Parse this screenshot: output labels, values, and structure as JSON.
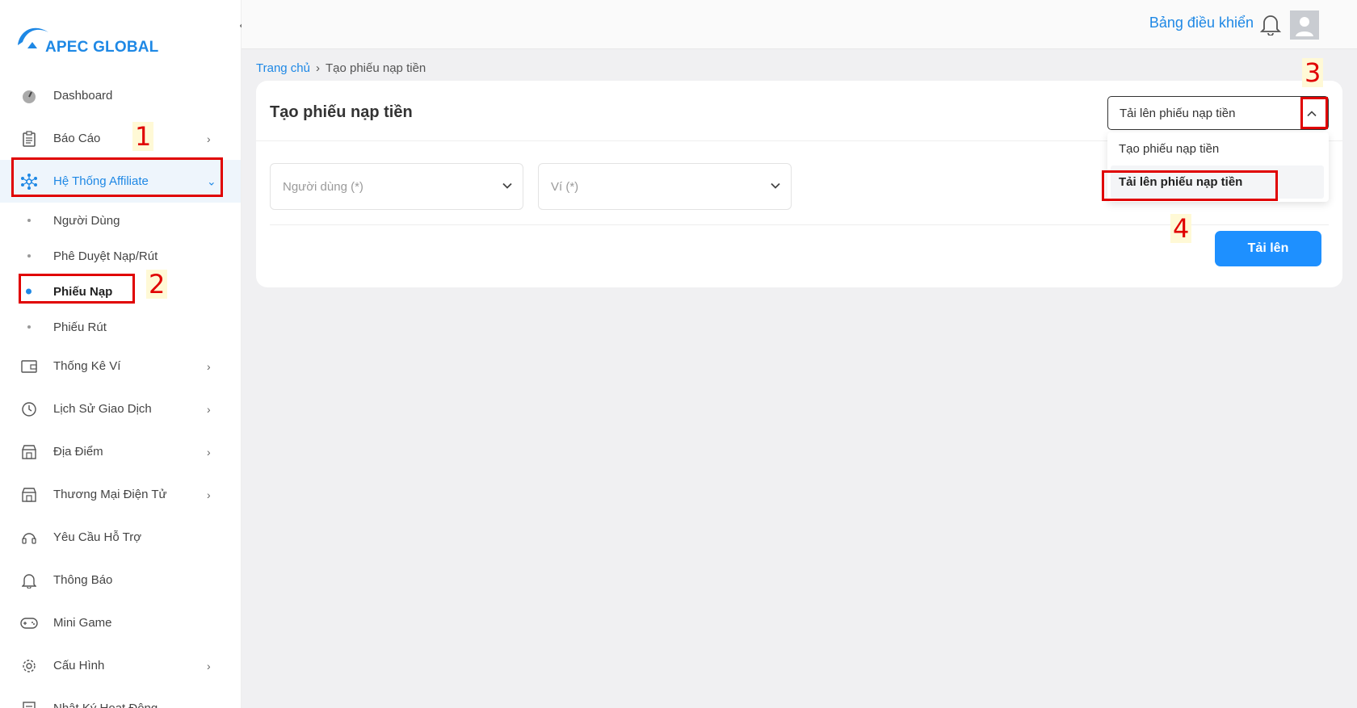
{
  "brand": {
    "name": "APEC GLOBAL"
  },
  "header": {
    "dashboard_link": "Bảng điều khiển"
  },
  "sidebar": {
    "items": [
      {
        "label": "Dashboard",
        "icon": "gauge-icon"
      },
      {
        "label": "Báo Cáo",
        "icon": "clipboard-icon"
      },
      {
        "label": "Hệ Thống Affiliate",
        "icon": "network-icon"
      },
      {
        "label": "Thống Kê Ví",
        "icon": "wallet-icon"
      },
      {
        "label": "Lịch Sử Giao Dịch",
        "icon": "clock-icon"
      },
      {
        "label": "Địa Điểm",
        "icon": "store-icon"
      },
      {
        "label": "Thương Mại Điện Tử",
        "icon": "store-icon"
      },
      {
        "label": "Yêu Cầu Hỗ Trợ",
        "icon": "headset-icon"
      },
      {
        "label": "Thông Báo",
        "icon": "bell-icon"
      },
      {
        "label": "Mini Game",
        "icon": "gamepad-icon"
      },
      {
        "label": "Cấu Hình",
        "icon": "gear-icon"
      },
      {
        "label": "Nhật Ký Hoạt Động",
        "icon": "log-icon"
      }
    ],
    "affiliate_sub": [
      {
        "label": "Người Dùng"
      },
      {
        "label": "Phê Duyệt Nạp/Rút"
      },
      {
        "label": "Phiếu Nạp"
      },
      {
        "label": "Phiếu Rút"
      }
    ]
  },
  "breadcrumb": {
    "home": "Trang chủ",
    "current": "Tạo phiếu nạp tiền"
  },
  "card": {
    "title": "Tạo phiếu nạp tiền",
    "user_placeholder": "Người dùng (*)",
    "wallet_placeholder": "Ví (*)",
    "mode_value": "Tải lên phiếu nạp tiền",
    "mode_options": [
      "Tạo phiếu nạp tiền",
      "Tải lên phiếu nạp tiền"
    ],
    "upload_label": "Tải lên"
  },
  "annotations": {
    "n1": "1",
    "n2": "2",
    "n3": "3",
    "n4": "4"
  },
  "colors": {
    "accent": "#1e88e5",
    "highlight": "#e00000"
  }
}
